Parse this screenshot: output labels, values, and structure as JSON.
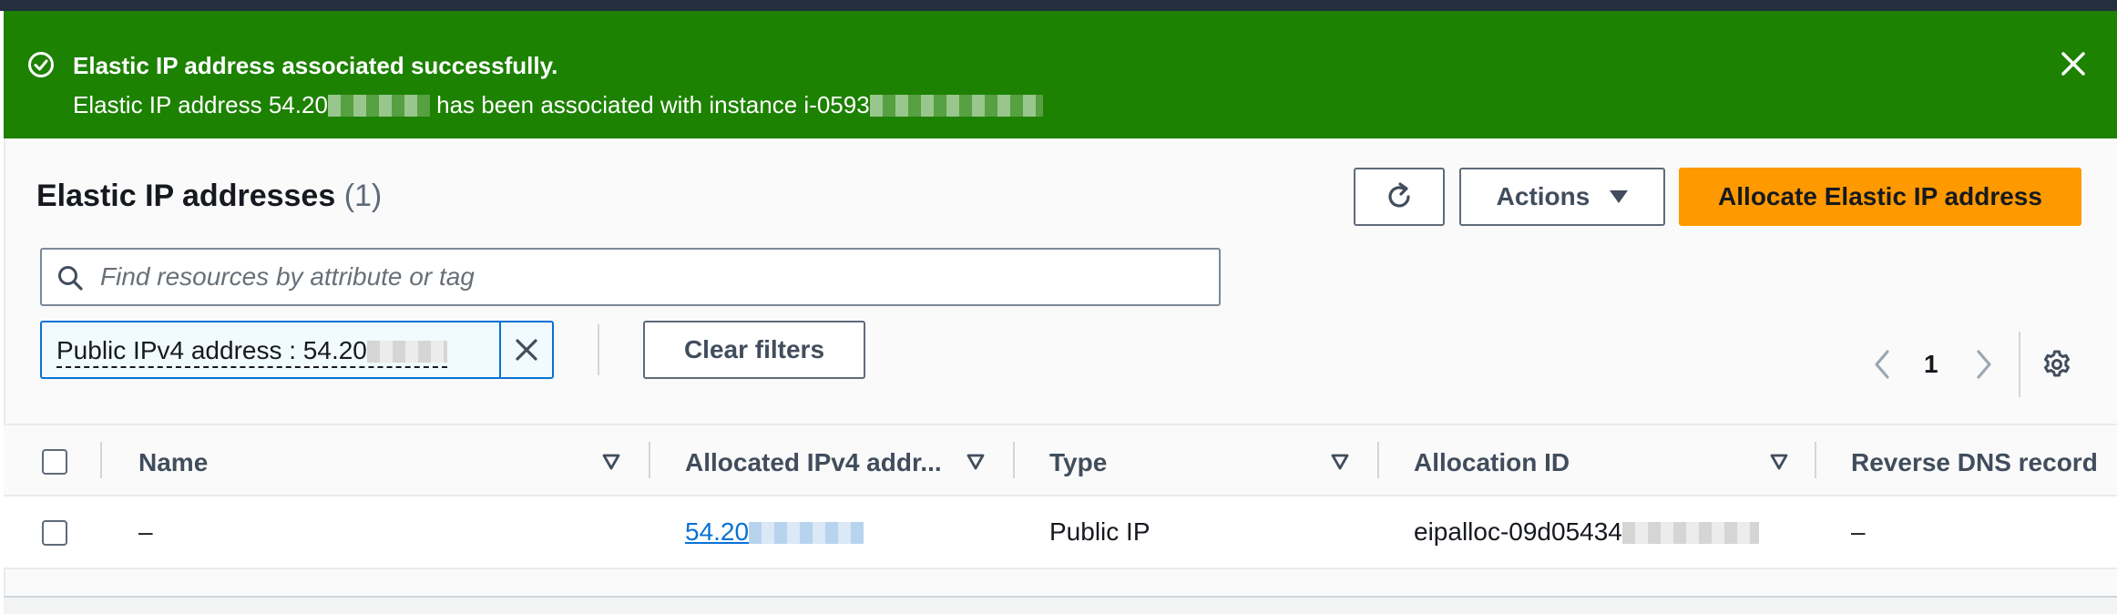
{
  "flash": {
    "title": "Elastic IP address associated successfully.",
    "message_prefix": "Elastic IP address 54.20",
    "message_middle": "has been associated with instance i-0593",
    "icon": "check-circle-icon",
    "color": "#1d8102"
  },
  "header": {
    "title": "Elastic IP addresses",
    "count": "(1)",
    "actions_label": "Actions",
    "allocate_label": "Allocate Elastic IP address",
    "accent_color": "#ff9900"
  },
  "search": {
    "placeholder": "Find resources by attribute or tag",
    "value": ""
  },
  "filter": {
    "token_label": "Public IPv4 address : 54.20",
    "clear_label": "Clear filters"
  },
  "pagination": {
    "current_page": "1"
  },
  "table": {
    "columns": [
      "Name",
      "Allocated IPv4 addr...",
      "Type",
      "Allocation ID",
      "Reverse DNS record"
    ],
    "rows": [
      {
        "name": "–",
        "ip": "54.20",
        "type": "Public IP",
        "allocation_id": "eipalloc-09d05434",
        "reverse_dns": "–"
      }
    ]
  }
}
